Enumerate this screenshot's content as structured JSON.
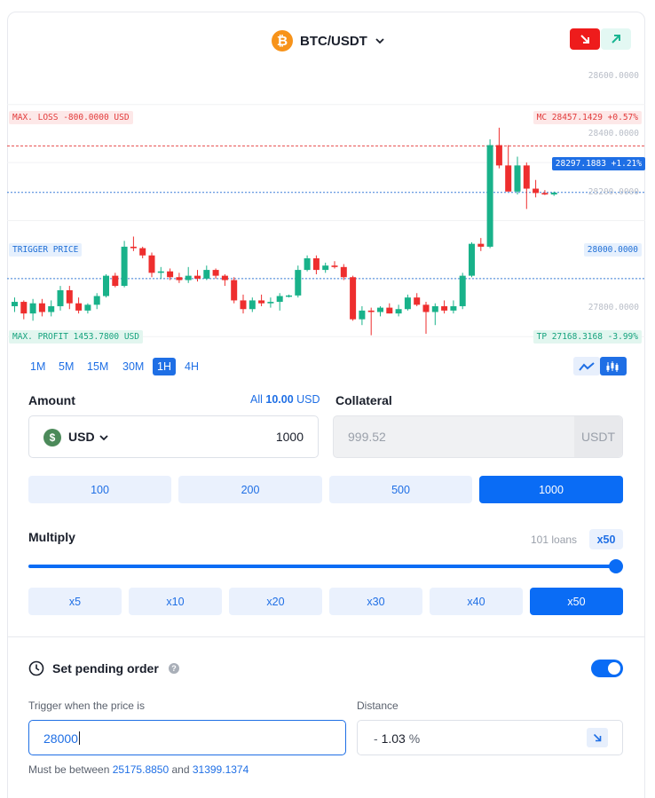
{
  "header": {
    "pair_label": "BTC/USDT",
    "coin_symbol": "₿",
    "coin_color": "#f7931a",
    "short_icon": "arrow-down-right-icon",
    "long_icon": "arrow-up-right-icon",
    "short_color": "#ee1c1c",
    "long_color": "#18b591"
  },
  "chart": {
    "y_ticks": [
      "28600.0000",
      "28400.0000",
      "28200.0000",
      "28000.0000",
      "27800.0000"
    ],
    "max_loss_label": "MAX. LOSS -800.0000 USD",
    "mc_label": "MC 28457.1429 +0.57%",
    "current_label": "28297.1883 +1.21%",
    "trigger_label": "TRIGGER PRICE",
    "trigger_value": "28000.0000",
    "max_profit_label": "MAX. PROFIT 1453.7800 USD",
    "tp_label": "TP 27168.3168 -3.99%",
    "colors": {
      "up": "#19b28a",
      "down": "#ee2e2e",
      "loss_line": "#e84c4c",
      "price_line": "#3d7fd9"
    }
  },
  "chart_data": {
    "type": "candlestick",
    "ylim": [
      27700,
      28700
    ],
    "y_ticks": [
      28600,
      28400,
      28200,
      28000,
      27800
    ],
    "levels": {
      "mc": 28457.1429,
      "current": 28297.1883,
      "trigger": 28000.0
    },
    "candles": [
      {
        "o": 27905,
        "h": 27935,
        "l": 27885,
        "c": 27920
      },
      {
        "o": 27920,
        "h": 27925,
        "l": 27860,
        "c": 27880
      },
      {
        "o": 27880,
        "h": 27930,
        "l": 27855,
        "c": 27915
      },
      {
        "o": 27915,
        "h": 27930,
        "l": 27870,
        "c": 27885
      },
      {
        "o": 27885,
        "h": 27925,
        "l": 27870,
        "c": 27905
      },
      {
        "o": 27905,
        "h": 27975,
        "l": 27890,
        "c": 27960
      },
      {
        "o": 27960,
        "h": 27975,
        "l": 27895,
        "c": 27915
      },
      {
        "o": 27915,
        "h": 27935,
        "l": 27880,
        "c": 27890
      },
      {
        "o": 27890,
        "h": 27915,
        "l": 27880,
        "c": 27910
      },
      {
        "o": 27910,
        "h": 27950,
        "l": 27895,
        "c": 27940
      },
      {
        "o": 27940,
        "h": 28015,
        "l": 27935,
        "c": 28010
      },
      {
        "o": 28010,
        "h": 28020,
        "l": 27970,
        "c": 27975
      },
      {
        "o": 27975,
        "h": 28130,
        "l": 27970,
        "c": 28110
      },
      {
        "o": 28110,
        "h": 28145,
        "l": 28095,
        "c": 28105
      },
      {
        "o": 28105,
        "h": 28110,
        "l": 28070,
        "c": 28080
      },
      {
        "o": 28080,
        "h": 28090,
        "l": 28005,
        "c": 28020
      },
      {
        "o": 28020,
        "h": 28040,
        "l": 28000,
        "c": 28025
      },
      {
        "o": 28025,
        "h": 28035,
        "l": 27995,
        "c": 28005
      },
      {
        "o": 28005,
        "h": 28020,
        "l": 27985,
        "c": 27995
      },
      {
        "o": 27995,
        "h": 28040,
        "l": 27985,
        "c": 28010
      },
      {
        "o": 28010,
        "h": 28030,
        "l": 27990,
        "c": 28000
      },
      {
        "o": 28000,
        "h": 28045,
        "l": 27995,
        "c": 28030
      },
      {
        "o": 28030,
        "h": 28035,
        "l": 28000,
        "c": 28010
      },
      {
        "o": 28010,
        "h": 28015,
        "l": 27975,
        "c": 27995
      },
      {
        "o": 27995,
        "h": 28005,
        "l": 27915,
        "c": 27925
      },
      {
        "o": 27925,
        "h": 27945,
        "l": 27880,
        "c": 27895
      },
      {
        "o": 27895,
        "h": 27935,
        "l": 27885,
        "c": 27925
      },
      {
        "o": 27925,
        "h": 27945,
        "l": 27905,
        "c": 27915
      },
      {
        "o": 27915,
        "h": 27935,
        "l": 27900,
        "c": 27920
      },
      {
        "o": 27920,
        "h": 27950,
        "l": 27890,
        "c": 27940
      },
      {
        "o": 27940,
        "h": 27945,
        "l": 27935,
        "c": 27942
      },
      {
        "o": 27942,
        "h": 28045,
        "l": 27935,
        "c": 28030
      },
      {
        "o": 28030,
        "h": 28080,
        "l": 28025,
        "c": 28070
      },
      {
        "o": 28070,
        "h": 28080,
        "l": 28015,
        "c": 28030
      },
      {
        "o": 28030,
        "h": 28055,
        "l": 28020,
        "c": 28045
      },
      {
        "o": 28045,
        "h": 28060,
        "l": 28035,
        "c": 28040
      },
      {
        "o": 28040,
        "h": 28050,
        "l": 27995,
        "c": 28005
      },
      {
        "o": 28005,
        "h": 28010,
        "l": 27855,
        "c": 27860
      },
      {
        "o": 27860,
        "h": 27905,
        "l": 27840,
        "c": 27890
      },
      {
        "o": 27890,
        "h": 27900,
        "l": 27805,
        "c": 27885
      },
      {
        "o": 27885,
        "h": 27905,
        "l": 27870,
        "c": 27900
      },
      {
        "o": 27900,
        "h": 27915,
        "l": 27880,
        "c": 27880
      },
      {
        "o": 27880,
        "h": 27910,
        "l": 27870,
        "c": 27895
      },
      {
        "o": 27895,
        "h": 27945,
        "l": 27890,
        "c": 27935
      },
      {
        "o": 27935,
        "h": 27950,
        "l": 27905,
        "c": 27910
      },
      {
        "o": 27910,
        "h": 27920,
        "l": 27810,
        "c": 27885
      },
      {
        "o": 27885,
        "h": 27915,
        "l": 27840,
        "c": 27905
      },
      {
        "o": 27905,
        "h": 27925,
        "l": 27880,
        "c": 27890
      },
      {
        "o": 27890,
        "h": 27925,
        "l": 27880,
        "c": 27905
      },
      {
        "o": 27905,
        "h": 28020,
        "l": 27895,
        "c": 28010
      },
      {
        "o": 28010,
        "h": 28125,
        "l": 28005,
        "c": 28120
      },
      {
        "o": 28120,
        "h": 28140,
        "l": 28095,
        "c": 28110
      },
      {
        "o": 28110,
        "h": 28480,
        "l": 28105,
        "c": 28460
      },
      {
        "o": 28460,
        "h": 28520,
        "l": 28380,
        "c": 28390
      },
      {
        "o": 28390,
        "h": 28460,
        "l": 28340,
        "c": 28300
      },
      {
        "o": 28300,
        "h": 28420,
        "l": 28290,
        "c": 28390
      },
      {
        "o": 28390,
        "h": 28400,
        "l": 28240,
        "c": 28310
      },
      {
        "o": 28310,
        "h": 28340,
        "l": 28280,
        "c": 28295
      },
      {
        "o": 28295,
        "h": 28305,
        "l": 28288,
        "c": 28290
      },
      {
        "o": 28290,
        "h": 28300,
        "l": 28285,
        "c": 28296
      }
    ]
  },
  "timeframes": [
    "1M",
    "5M",
    "15M",
    "30M",
    "1H",
    "4H"
  ],
  "active_timeframe": "1H",
  "chart_type_icons": [
    "line-chart-icon",
    "candlestick-chart-icon"
  ],
  "amount": {
    "label": "Amount",
    "all_prefix": "All",
    "all_value": "10.00",
    "all_unit": "USD",
    "currency_symbol": "$",
    "currency_label": "USD",
    "value": "1000",
    "presets": [
      "100",
      "200",
      "500",
      "1000"
    ],
    "active_preset": "1000"
  },
  "collateral": {
    "label": "Collateral",
    "value": "999.52",
    "unit": "USDT"
  },
  "multiply": {
    "label": "Multiply",
    "loans": "101 loans",
    "current": "x50",
    "slider_fraction": 1.0,
    "options": [
      "x5",
      "x10",
      "x20",
      "x30",
      "x40",
      "x50"
    ],
    "active_option": "x50"
  },
  "pending": {
    "title": "Set pending order",
    "help_symbol": "?",
    "enabled": true,
    "trigger_label": "Trigger when the price is",
    "trigger_value": "28000",
    "distance_label": "Distance",
    "distance_sign": "-",
    "distance_value": "1.03",
    "distance_unit": "%",
    "hint_prefix": "Must be between",
    "hint_min": "25175.8850",
    "hint_and": "and",
    "hint_max": "31399.1374"
  }
}
